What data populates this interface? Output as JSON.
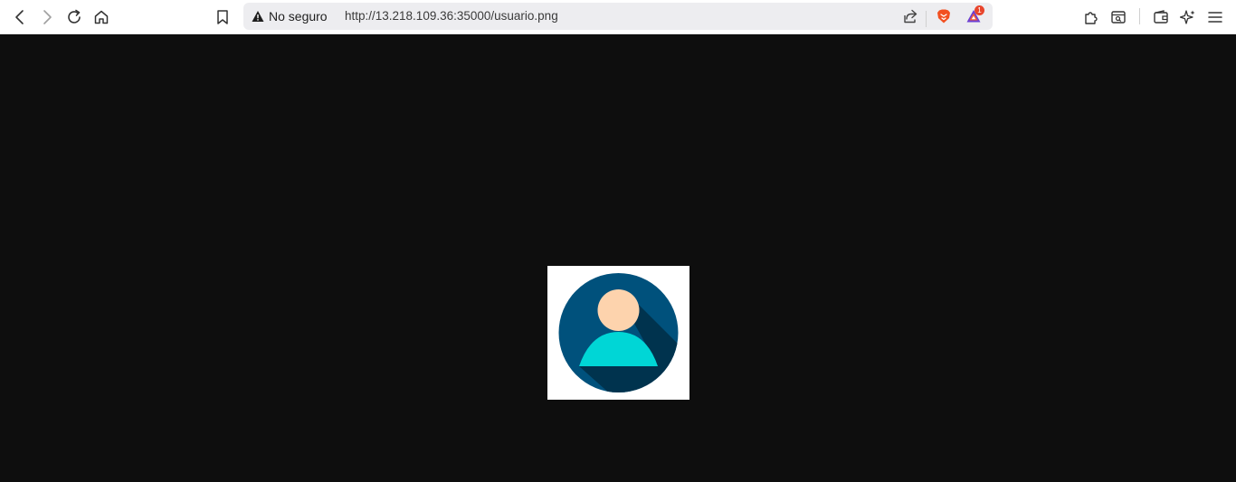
{
  "browser": {
    "security_label": "No seguro",
    "url": "http://13.218.109.36:35000/usuario.png",
    "notification_count": "1",
    "icons": {
      "back": "back-arrow-icon",
      "forward": "forward-arrow-icon",
      "reload": "reload-icon",
      "home": "home-icon",
      "bookmark": "bookmark-icon",
      "warning": "warning-triangle-icon",
      "share": "share-icon",
      "brave_shields": "brave-lion-icon",
      "brave_rewards": "rewards-triangle-icon",
      "extensions": "puzzle-icon",
      "leo": "sidebar-search-icon",
      "wallet": "wallet-icon",
      "ai": "sparkle-icon",
      "menu": "hamburger-menu-icon"
    }
  },
  "content": {
    "background_color": "#0e0e0e",
    "image": {
      "name": "usuario.png",
      "colors": {
        "circle": "#00517c",
        "shadow": "#00334e",
        "head": "#fdd3ad",
        "body": "#00d6d6"
      }
    }
  }
}
